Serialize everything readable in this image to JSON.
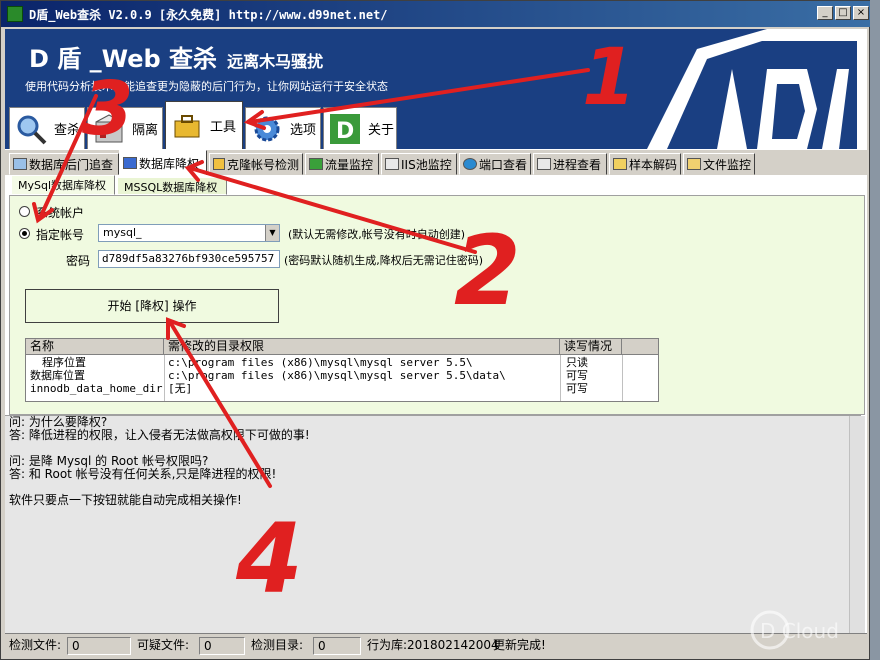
{
  "window": {
    "title": "D盾_Web查杀 V2.0.9 [永久免费] http://www.d99net.net/"
  },
  "banner": {
    "brand": "D 盾 _Web 查杀",
    "tagline": "远离木马骚扰",
    "slogan": "使用代码分析技术，能追查更为隐蔽的后门行为，让你网站运行于安全状态"
  },
  "main_tabs": [
    {
      "label": "查杀",
      "icon": "magnifier-icon"
    },
    {
      "label": "隔离",
      "icon": "box-icon"
    },
    {
      "label": "工具",
      "icon": "toolbox-icon"
    },
    {
      "label": "选项",
      "icon": "gear-icon"
    },
    {
      "label": "关于",
      "icon": "d-logo-icon"
    }
  ],
  "sub_tabs": [
    {
      "label": "数据库后门追查"
    },
    {
      "label": "数据库降权"
    },
    {
      "label": "克隆帐号检测"
    },
    {
      "label": "流量监控"
    },
    {
      "label": "IIS池监控"
    },
    {
      "label": "端口查看"
    },
    {
      "label": "进程查看"
    },
    {
      "label": "样本解码"
    },
    {
      "label": "文件监控"
    }
  ],
  "inner_tabs": [
    {
      "label": "MySql数据库降权"
    },
    {
      "label": "MSSQL数据库降权"
    }
  ],
  "form": {
    "radio_system": "系统帐户",
    "radio_specified": "指定帐号",
    "account_value": "mysql_",
    "account_hint": "(默认无需修改,帐号没有时自动创建)",
    "password_label": "密码",
    "password_value": "d789df5a83276bf930ce595757",
    "password_hint": "(密码默认随机生成,降权后无需记住密码)",
    "start_button": "开始 [降权] 操作"
  },
  "table": {
    "headers": [
      "名称",
      "需修改的目录权限",
      "读写情况"
    ],
    "rows": [
      {
        "name": "程序位置",
        "path": "c:\\program files (x86)\\mysql\\mysql server 5.5\\",
        "perm": "只读"
      },
      {
        "name": "数据库位置",
        "path": "c:\\program files (x86)\\mysql\\mysql server 5.5\\data\\",
        "perm": "可写"
      },
      {
        "name": "innodb_data_home_dir",
        "path": "[无]",
        "perm": "可写"
      }
    ]
  },
  "log": {
    "lines": [
      "问: 为什么要降权?",
      "答: 降低进程的权限，让入侵者无法做高权限下可做的事!",
      "",
      "问: 是降 Mysql 的 Root 帐号权限吗?",
      "答: 和 Root 帐号没有任何关系,只是降进程的权限!",
      "",
      "软件只要点一下按钮就能自动完成相关操作!"
    ]
  },
  "status": {
    "detected_files_label": "检测文件:",
    "detected_files_value": "0",
    "suspicious_files_label": "可疑文件:",
    "suspicious_files_value": "0",
    "detected_dirs_label": "检测目录:",
    "detected_dirs_value": "0",
    "behavior_lib": "行为库:201802142004",
    "update_status": "更新完成!"
  },
  "annotations": [
    "1",
    "2",
    "3",
    "4"
  ],
  "watermark": "D Cloud"
}
